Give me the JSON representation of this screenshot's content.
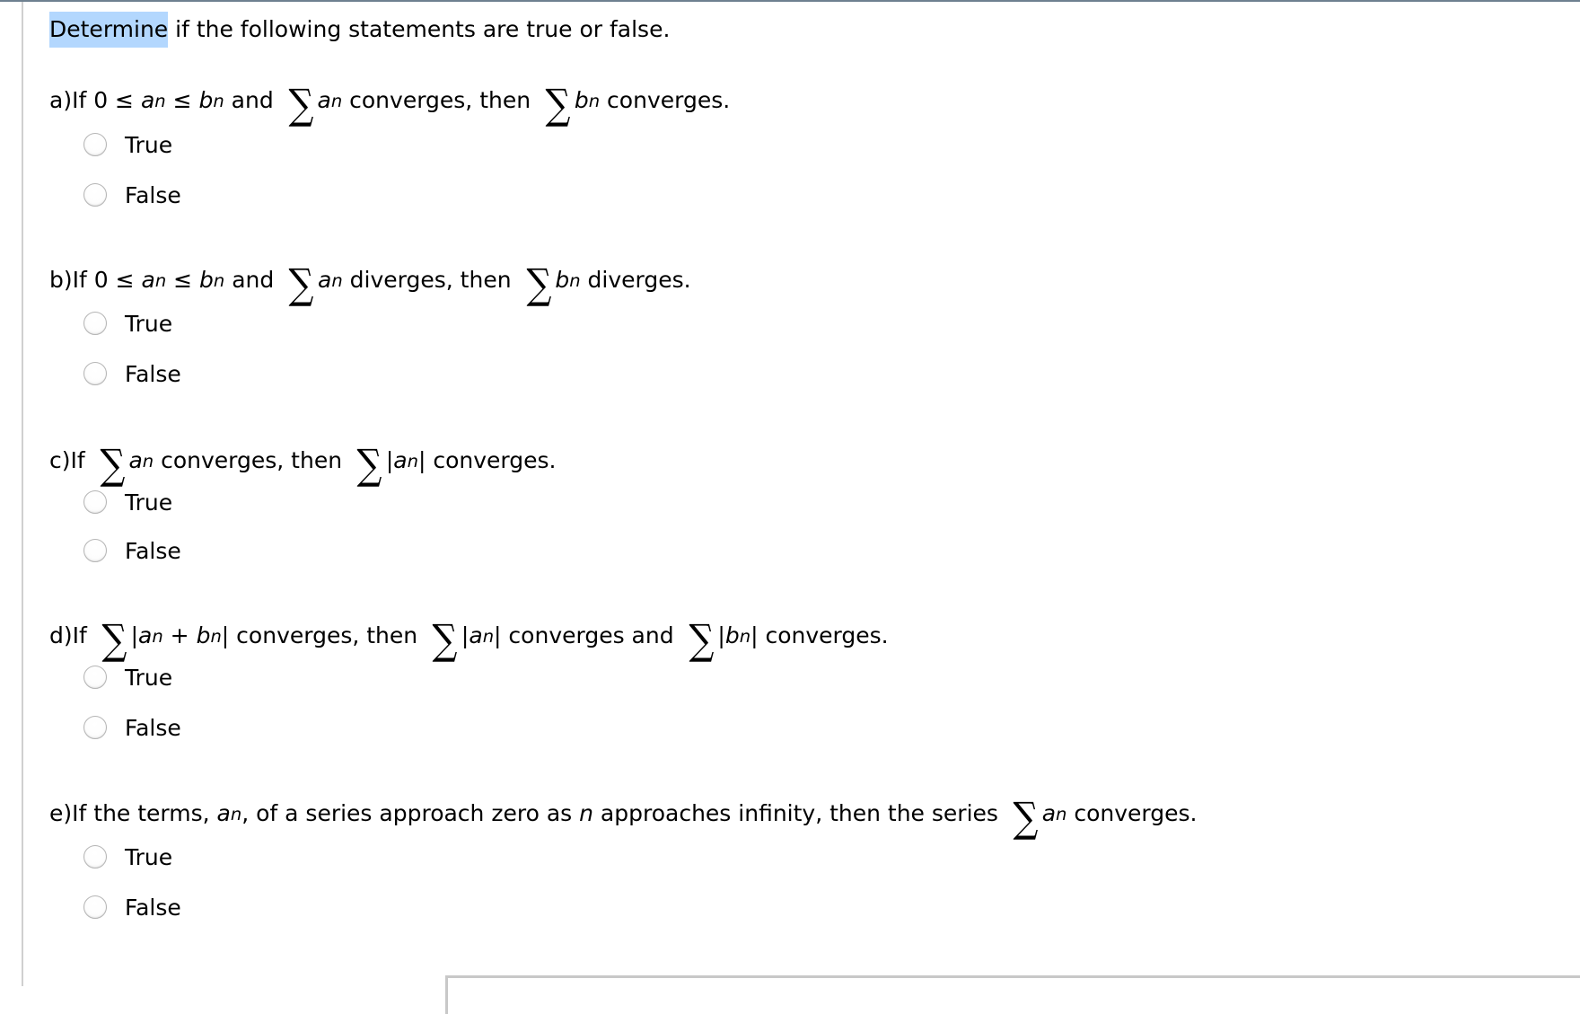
{
  "instructions": {
    "highlighted_word": "Determine",
    "rest": " if the following statements are true or false."
  },
  "colors": {
    "selection_highlight": "#b3d7fe",
    "top_bar": "#6e8090",
    "rule": "#d0d0d0"
  },
  "sigma_symbol": "∑",
  "questions": [
    {
      "label": "a)",
      "parts": {
        "p1": "If 0 ≤ ",
        "a": "a",
        "n": "n",
        "p2": " ≤ ",
        "b": "b",
        "p3": " and ",
        "s1_var": "a",
        "p4": " converges, then ",
        "s2_var": "b",
        "p5": " converges."
      },
      "options": [
        "True",
        "False"
      ]
    },
    {
      "label": "b)",
      "parts": {
        "p1": "If 0 ≤ ",
        "a": "a",
        "n": "n",
        "p2": " ≤ ",
        "b": "b",
        "p3": " and ",
        "s1_var": "a",
        "p4": " diverges, then ",
        "s2_var": "b",
        "p5": " diverges."
      },
      "options": [
        "True",
        "False"
      ]
    },
    {
      "label": "c)",
      "parts": {
        "p1": "If ",
        "s1_var": "a",
        "n": "n",
        "p2": " converges, then ",
        "abs_open": "|",
        "s2_var": "a",
        "abs_close": "|",
        "p3": " converges."
      },
      "options": [
        "True",
        "False"
      ]
    },
    {
      "label": "d)",
      "parts": {
        "p1": "If ",
        "abs_open": "|",
        "a": "a",
        "n": "n",
        "plus": " + ",
        "b": "b",
        "abs_close": "|",
        "p2": " converges, then ",
        "p3": " converges and ",
        "p4": " converges."
      },
      "options": [
        "True",
        "False"
      ]
    },
    {
      "label": "e)",
      "parts": {
        "p1": "If the terms, ",
        "a": "a",
        "n": "n",
        "p2": ", of a series approach zero as ",
        "nvar": "n",
        "p3": " approaches infinity, then the series ",
        "p4": " converges."
      },
      "options": [
        "True",
        "False"
      ]
    }
  ]
}
